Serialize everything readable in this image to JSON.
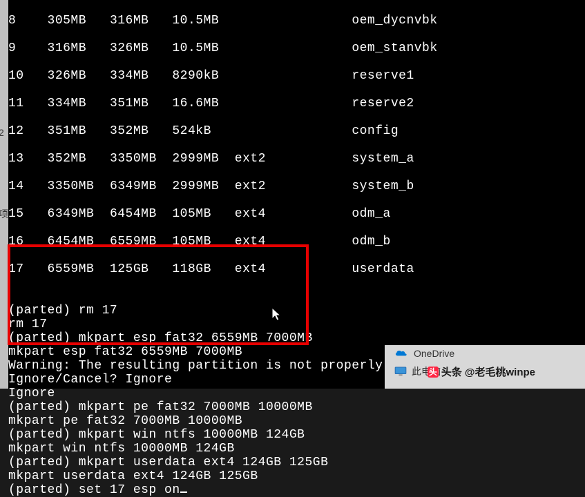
{
  "left_labels": {
    "a": "2",
    "b": "项"
  },
  "partitions": [
    {
      "num": "8",
      "start": "305MB",
      "end": "316MB",
      "size": "10.5MB",
      "fs": "",
      "name": "oem_dycnvbk"
    },
    {
      "num": "9",
      "start": "316MB",
      "end": "326MB",
      "size": "10.5MB",
      "fs": "",
      "name": "oem_stanvbk"
    },
    {
      "num": "10",
      "start": "326MB",
      "end": "334MB",
      "size": "8290kB",
      "fs": "",
      "name": "reserve1"
    },
    {
      "num": "11",
      "start": "334MB",
      "end": "351MB",
      "size": "16.6MB",
      "fs": "",
      "name": "reserve2"
    },
    {
      "num": "12",
      "start": "351MB",
      "end": "352MB",
      "size": "524kB",
      "fs": "",
      "name": "config"
    },
    {
      "num": "13",
      "start": "352MB",
      "end": "3350MB",
      "size": "2999MB",
      "fs": "ext2",
      "name": "system_a"
    },
    {
      "num": "14",
      "start": "3350MB",
      "end": "6349MB",
      "size": "2999MB",
      "fs": "ext2",
      "name": "system_b"
    },
    {
      "num": "15",
      "start": "6349MB",
      "end": "6454MB",
      "size": "105MB",
      "fs": "ext4",
      "name": "odm_a"
    },
    {
      "num": "16",
      "start": "6454MB",
      "end": "6559MB",
      "size": "105MB",
      "fs": "ext4",
      "name": "odm_b"
    },
    {
      "num": "17",
      "start": "6559MB",
      "end": "125GB",
      "size": "118GB",
      "fs": "ext4",
      "name": "userdata"
    }
  ],
  "session": {
    "lines": [
      "(parted) rm 17",
      "rm 17",
      "(parted) mkpart esp fat32 6559MB 7000MB",
      "mkpart esp fat32 6559MB 7000MB",
      "Warning: The resulting partition is not properly aligned for best performance.",
      "Ignore/Cancel? Ignore",
      "Ignore",
      "(parted) mkpart pe fat32 7000MB 10000MB",
      "mkpart pe fat32 7000MB 10000MB",
      "(parted) mkpart win ntfs 10000MB 124GB",
      "mkpart win ntfs 10000MB 124GB",
      "(parted) mkpart userdata ext4 124GB 125GB",
      "mkpart userdata ext4 124GB 125GB",
      "(parted) set 17 esp on"
    ]
  },
  "desktop": {
    "onedrive": "OneDrive",
    "thispc": "此电脑"
  },
  "watermark": {
    "prefix": "头条",
    "handle": "@老毛桃winpe"
  }
}
